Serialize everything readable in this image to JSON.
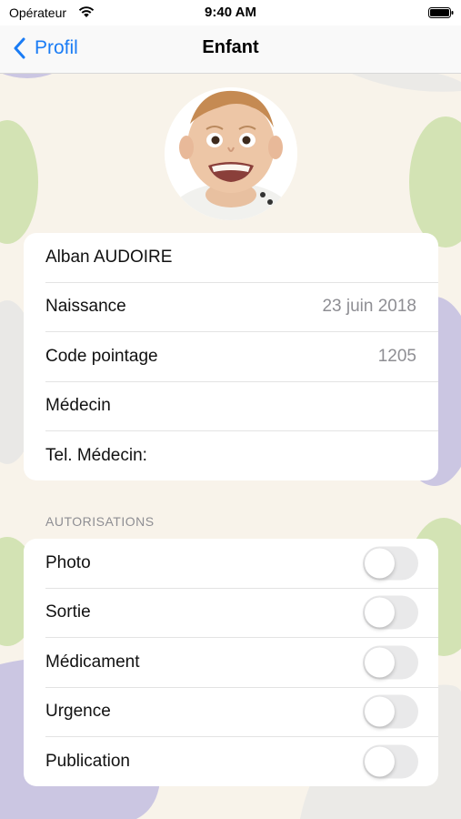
{
  "status_bar": {
    "carrier": "Opérateur",
    "time": "9:40 AM"
  },
  "nav": {
    "back_label": "Profil",
    "title": "Enfant",
    "accent_color": "#1a7cf5"
  },
  "child": {
    "name": "Alban AUDOIRE",
    "details": [
      {
        "label": "Naissance",
        "value": "23 juin 2018"
      },
      {
        "label": "Code pointage",
        "value": "1205"
      },
      {
        "label": "Médecin",
        "value": ""
      },
      {
        "label": "Tel. Médecin:",
        "value": ""
      }
    ]
  },
  "authorizations": {
    "header": "AUTORISATIONS",
    "items": [
      {
        "label": "Photo",
        "enabled": false
      },
      {
        "label": "Sortie",
        "enabled": false
      },
      {
        "label": "Médicament",
        "enabled": false
      },
      {
        "label": "Urgence",
        "enabled": false
      },
      {
        "label": "Publication",
        "enabled": false
      }
    ]
  },
  "icons": {
    "back": "chevron-left-icon",
    "wifi": "wifi-icon",
    "battery": "battery-icon"
  }
}
